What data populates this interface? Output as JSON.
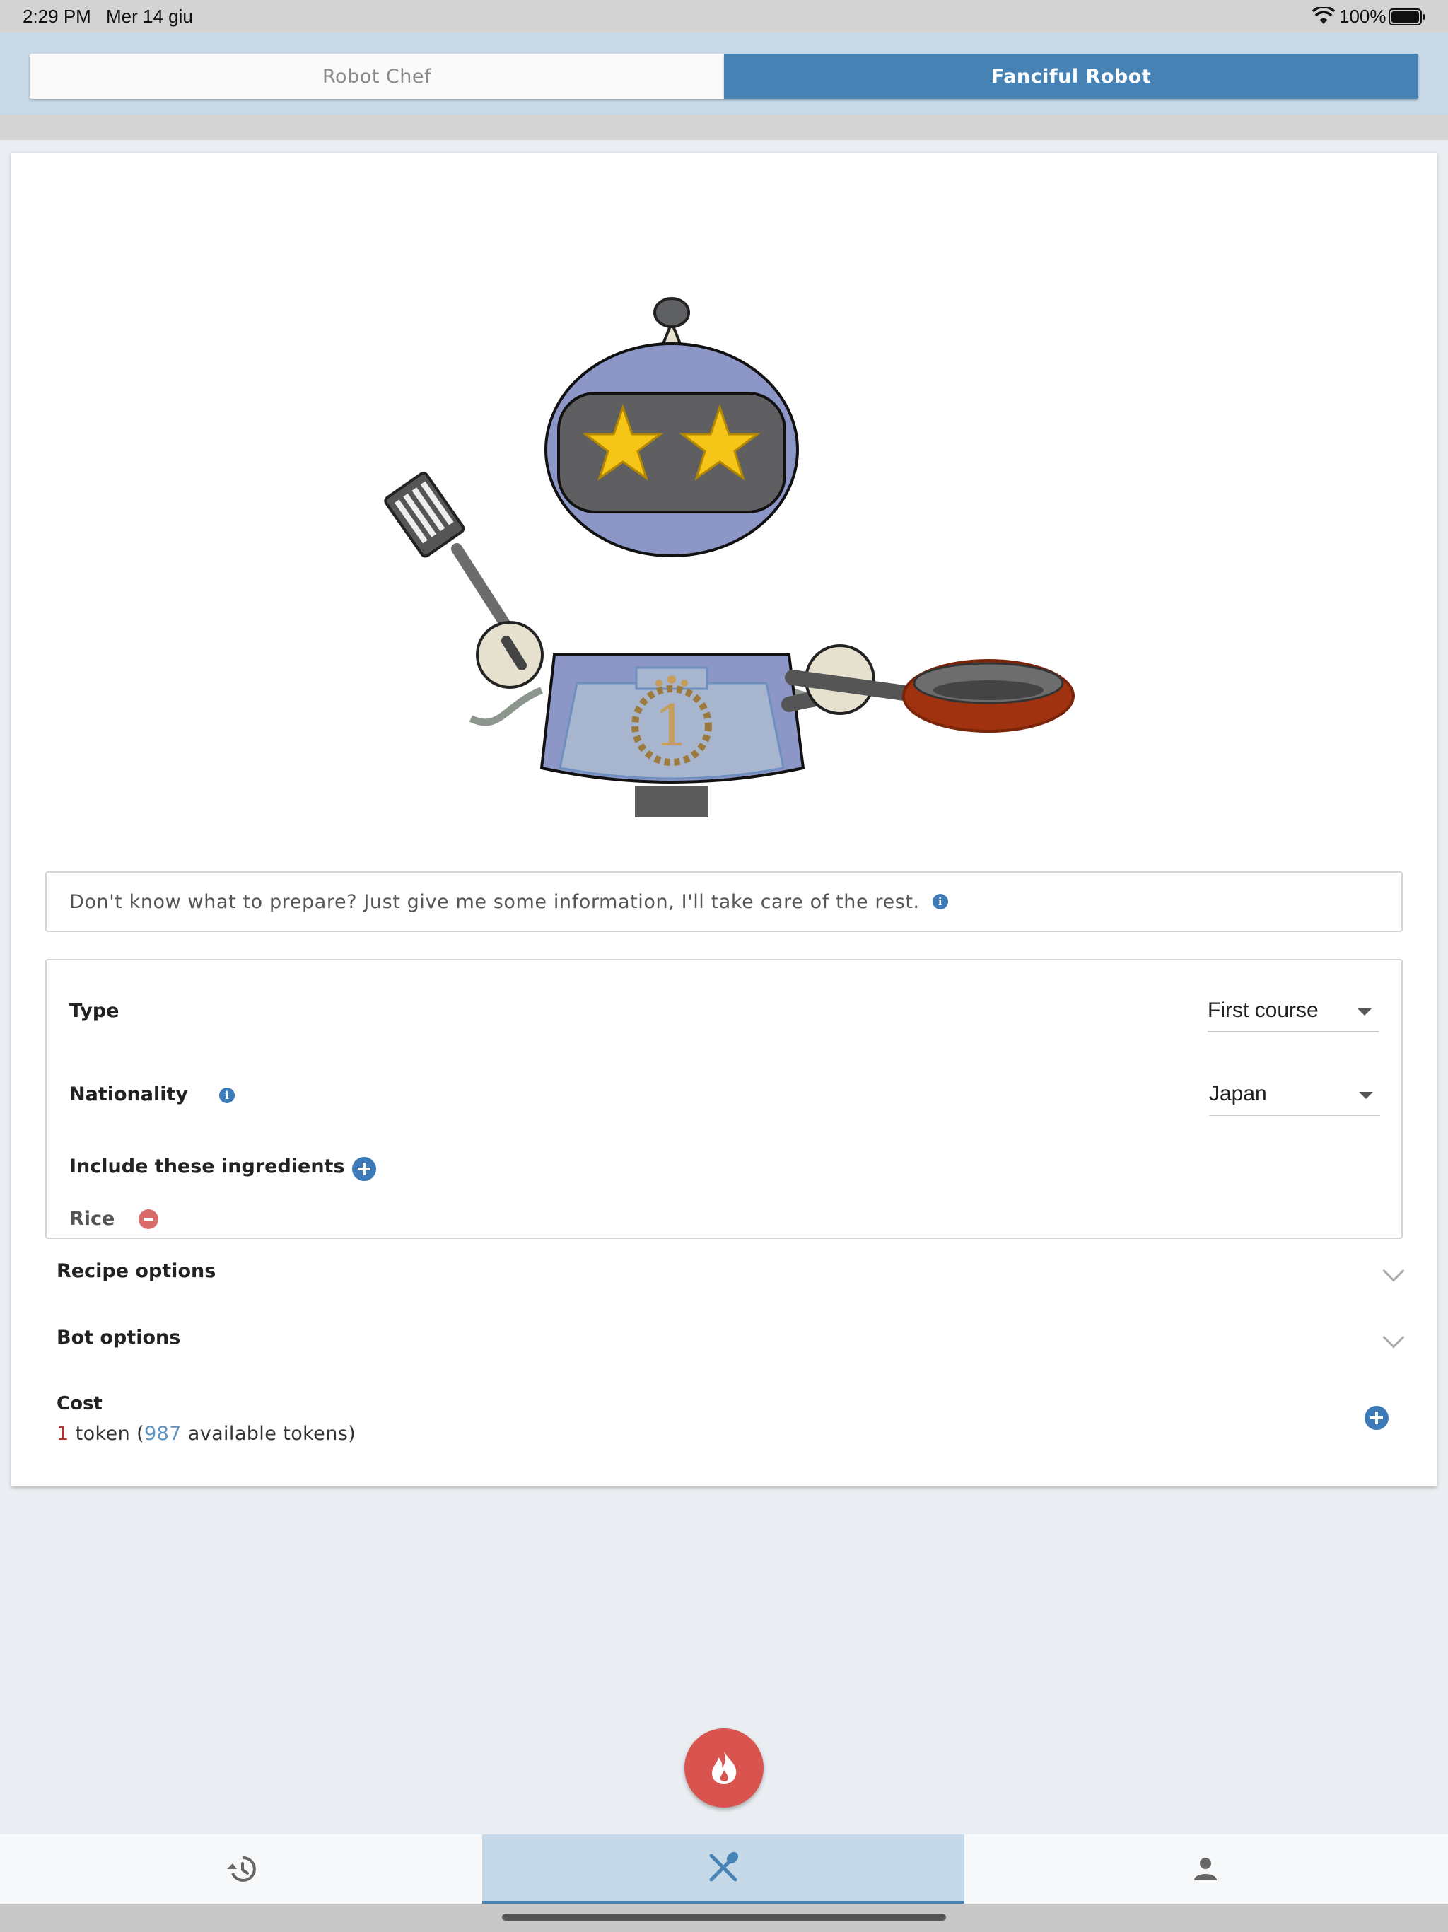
{
  "status_bar": {
    "time": "2:29 PM",
    "date": "Mer 14 giu",
    "battery": "100%"
  },
  "tabs": {
    "left_label": "Robot Chef",
    "right_label": "Fanciful Robot",
    "active": "Fanciful Robot"
  },
  "intro": {
    "text": "Don't know what to prepare? Just give me some information, I'll take care of the rest.",
    "info_icon": "info-icon"
  },
  "form": {
    "type_label": "Type",
    "type_value": "First course",
    "nationality_label": "Nationality",
    "nationality_value": "Japan",
    "ingredients_label": "Include these ingredients",
    "ingredients": [
      "Rice"
    ]
  },
  "sections": {
    "recipe_options": "Recipe options",
    "bot_options": "Bot options"
  },
  "cost": {
    "label": "Cost",
    "tokens": "1",
    "token_word": "token",
    "available": "987",
    "available_suffix": "available tokens"
  },
  "bottom_nav": {
    "items": [
      "history-icon",
      "cutlery-icon",
      "person-icon"
    ],
    "active_index": 1
  },
  "colors": {
    "accent": "#4682b4",
    "fab": "#d9534f",
    "remove": "#d96b6b",
    "cost_red": "#b3312b",
    "cost_blue": "#5a93c4"
  }
}
